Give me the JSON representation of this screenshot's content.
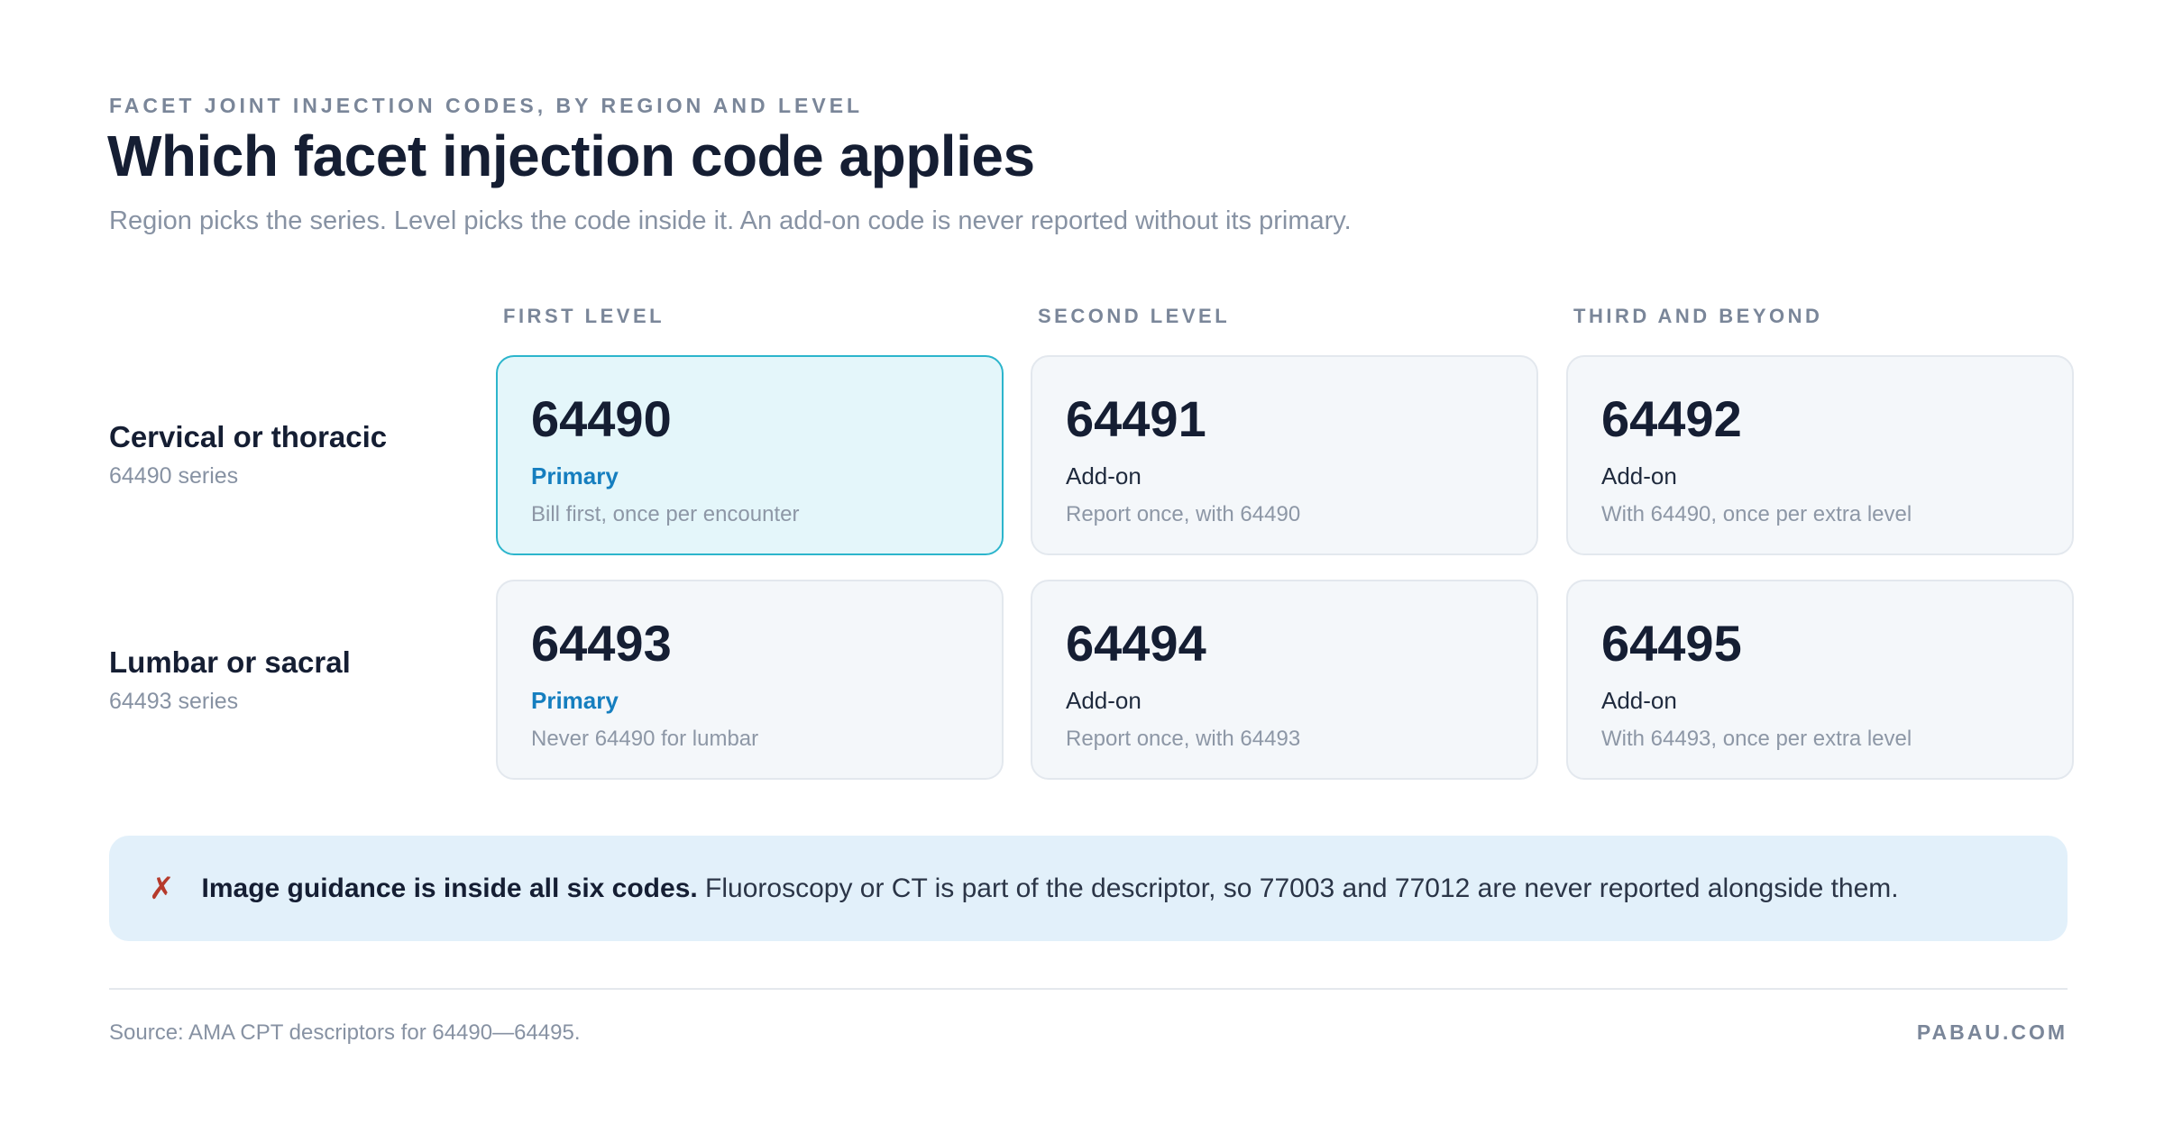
{
  "header": {
    "eyebrow": "FACET JOINT INJECTION CODES, BY REGION AND LEVEL",
    "title": "Which facet injection code applies",
    "subtitle": "Region picks the series. Level picks the code inside it. An add-on code is never reported without its primary."
  },
  "columns": [
    "FIRST LEVEL",
    "SECOND LEVEL",
    "THIRD AND BEYOND"
  ],
  "rows": [
    {
      "label": "Cervical or thoracic",
      "series": "64490 series",
      "cards": [
        {
          "code": "64490",
          "role": "Primary",
          "note": "Bill first, once per encounter",
          "highlighted": true
        },
        {
          "code": "64491",
          "role": "Add-on",
          "note": "Report once, with 64490"
        },
        {
          "code": "64492",
          "role": "Add-on",
          "note": "With 64490, once per extra level"
        }
      ]
    },
    {
      "label": "Lumbar or sacral",
      "series": "64493 series",
      "cards": [
        {
          "code": "64493",
          "role": "Primary",
          "note": "Never 64490 for lumbar"
        },
        {
          "code": "64494",
          "role": "Add-on",
          "note": "Report once, with 64493"
        },
        {
          "code": "64495",
          "role": "Add-on",
          "note": "With 64493, once per extra level"
        }
      ]
    }
  ],
  "callout": {
    "icon": "x-mark-icon",
    "bold": "Image guidance is inside all six codes.",
    "text": " Fluoroscopy or CT is part of the descriptor, so 77003 and 77012 are never reported alongside them."
  },
  "footer": {
    "source": "Source: AMA CPT descriptors for 64490—64495.",
    "brand": "PABAU.COM"
  },
  "colors": {
    "accent_blue": "#157ebf",
    "highlight_border": "#2cb5cc",
    "highlight_bg": "#e4f6fa",
    "callout_bg": "#e2f0fa",
    "error_red": "#b63a2b"
  }
}
